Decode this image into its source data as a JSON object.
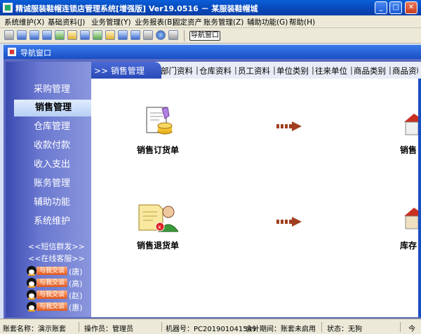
{
  "window": {
    "title": "精诚服装鞋帽连锁店管理系统[增强版] Ver19.0516 － 某服装鞋帽城"
  },
  "menu": [
    "系统维护(X)",
    "基础资料(J)",
    "业务管理(Y)",
    "业务报表(B)",
    "固定资产",
    "账务管理(Z)",
    "辅助功能(G)",
    "帮助(H)"
  ],
  "toolbar": {
    "nav_button_label": "导航窗口"
  },
  "nav_window": {
    "title": "导航窗口"
  },
  "sidebar": {
    "items": [
      "采购管理",
      "销售管理",
      "仓库管理",
      "收款付款",
      "收入支出",
      "账务管理",
      "辅助功能",
      "系统维护"
    ],
    "active_index": 1,
    "sms_link": "<<短信群发>>",
    "service_link": "<<在线客服>>",
    "qq_badge": "与我交谈",
    "qq_contacts": [
      "(唐)",
      "(高)",
      "(赵)",
      "(惠)"
    ]
  },
  "header": {
    "section": ">> 销售管理",
    "links": [
      "部门资料",
      "仓库资料",
      "员工资料",
      "单位类别",
      "往来单位",
      "商品类别",
      "商品资料"
    ]
  },
  "content": {
    "tiles": [
      "销售订货单",
      "销售退货单"
    ],
    "right_tiles": [
      "销售",
      "库存"
    ]
  },
  "statusbar": {
    "account": "账套名称：演示账套",
    "operator": "操作员：管理员",
    "machine": "机器号：PC201901041549",
    "period": "会计期间：账套未启用",
    "state": "状态：无狗",
    "clock": "今"
  }
}
